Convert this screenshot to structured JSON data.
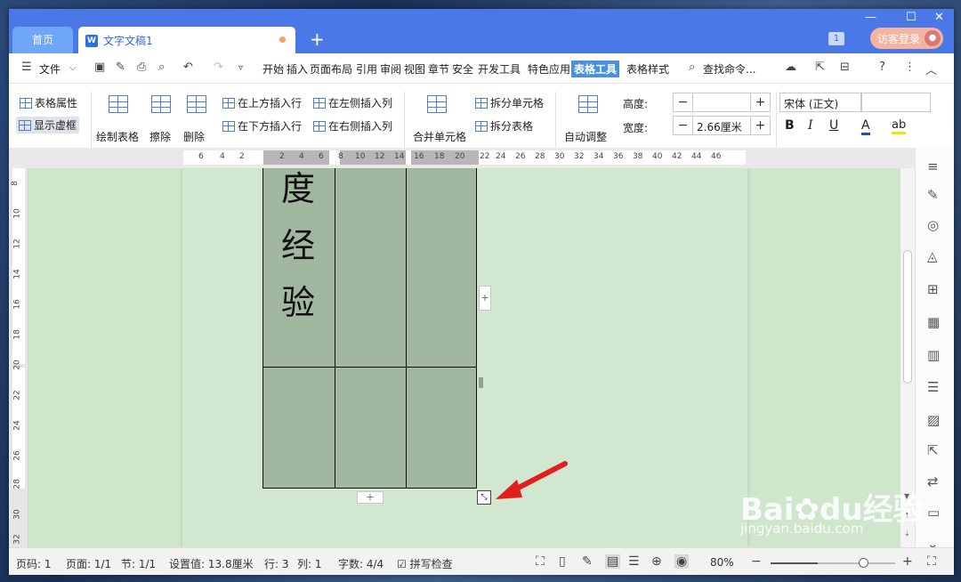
{
  "titlebar": {
    "home_tab": "首页",
    "doc_tab": "文字文稿1",
    "doc_icon": "W",
    "notification_count": "1",
    "login_label": "访客登录"
  },
  "menubar": {
    "file_label": "文件",
    "items": [
      "开始",
      "插入",
      "页面布局",
      "引用",
      "审阅",
      "视图",
      "章节",
      "安全",
      "开发工具",
      "特色应用",
      "表格工具",
      "表格样式"
    ],
    "active": "表格工具",
    "search_label": "查找命令..."
  },
  "ribbon": {
    "table_props": "表格属性",
    "show_gridlines": "显示虚框",
    "draw_table": "绘制表格",
    "erase": "擦除",
    "delete": "删除",
    "insert_above": "在上方插入行",
    "insert_below": "在下方插入行",
    "insert_left": "在左侧插入列",
    "insert_right": "在右侧插入列",
    "merge_cells": "合并单元格",
    "split_cells": "拆分单元格",
    "split_table": "拆分表格",
    "auto_fit": "自动调整",
    "height_label": "高度:",
    "height_value": "",
    "width_label": "宽度:",
    "width_value": "2.66厘米",
    "font_name": "宋体 (正文)",
    "font_size": ""
  },
  "ruler": {
    "h_ticks": [
      "6",
      "4",
      "2",
      "2",
      "4",
      "6",
      "8",
      "10",
      "12",
      "14",
      "16",
      "18",
      "20",
      "22",
      "24",
      "26",
      "28",
      "30",
      "32",
      "34",
      "36",
      "38",
      "40",
      "42",
      "44",
      "46"
    ],
    "v_ticks": [
      "8",
      "10",
      "12",
      "14",
      "16",
      "18",
      "20",
      "22",
      "24",
      "26",
      "28",
      "30",
      "32"
    ]
  },
  "document": {
    "cell_chars": [
      "度",
      "经",
      "验"
    ]
  },
  "status": {
    "page_no": "页码: 1",
    "pages": "页面: 1/1",
    "section": "节: 1/1",
    "setting": "设置值: 13.8厘米",
    "row": "行: 3",
    "col": "列: 1",
    "words": "字数: 4/4",
    "spell": "拼写检查",
    "zoom": "80%",
    "zoom_fraction": 0.38
  },
  "watermark": {
    "brand": "Bai",
    "brand2": "du",
    "brand3": "经验",
    "url": "jingyan.baidu.com"
  }
}
